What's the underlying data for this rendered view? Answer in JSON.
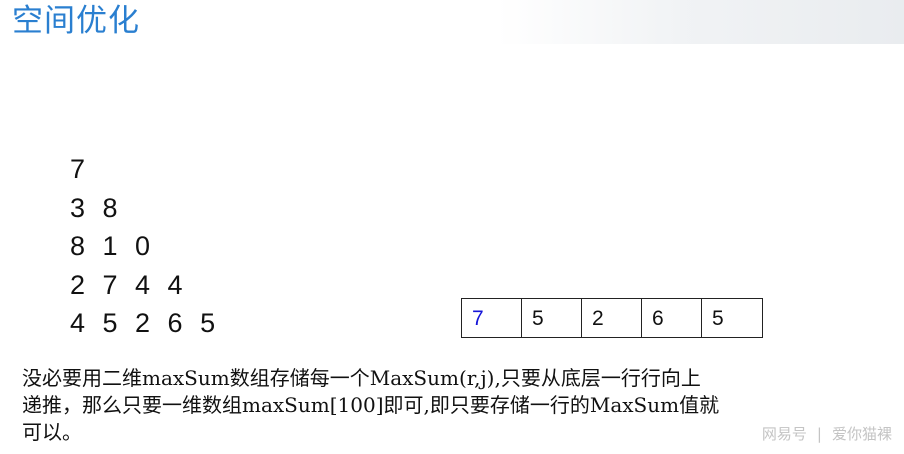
{
  "title": "空间优化",
  "triangle": [
    "7",
    "3 8",
    "8 1 0",
    "2 7 4 4",
    "4 5 2 6 5"
  ],
  "array_cells": [
    {
      "value": "7",
      "color": "#1515d8"
    },
    {
      "value": "5",
      "color": "#111111"
    },
    {
      "value": "2",
      "color": "#111111"
    },
    {
      "value": "6",
      "color": "#111111"
    },
    {
      "value": "5",
      "color": "#111111"
    }
  ],
  "description": {
    "line1": " 没必要用二维maxSum数组存储每一个MaxSum(r,j),只要从底层一行行向上",
    "line2": "递推，那么只要一维数组maxSum[100]即可,即只要存储一行的MaxSum值就",
    "line3": "可以。"
  },
  "watermark": {
    "source": "网易号",
    "separator": "|",
    "author": "爱你猫裸"
  },
  "colors": {
    "title": "#2a7fd0",
    "highlight_cell": "#1515d8",
    "text": "#111111"
  }
}
